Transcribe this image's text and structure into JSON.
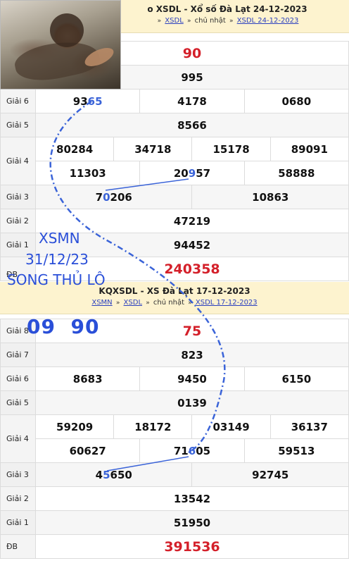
{
  "section1": {
    "title": "KQXSDL - XS Đà Lạt 24-12-2023",
    "title_visible": "o XSDL - Xổ số Đà Lạt 24-12-2023",
    "crumbs": [
      "XSDL",
      "chủ nhật",
      "XSDL 24-12-2023"
    ],
    "prizes": {
      "g8": "90",
      "g7": "995",
      "g6": [
        "9365",
        "4178",
        "0680"
      ],
      "g5": "8566",
      "g4_row1": [
        "80284",
        "34718",
        "15178",
        "89091"
      ],
      "g4_row2": [
        "11303",
        "20957",
        "58888"
      ],
      "g3": [
        "70206",
        "10863"
      ],
      "g2": "47219",
      "g1": "94452",
      "db": "240358"
    }
  },
  "section2": {
    "title": "KQXSDL - XS Đà Lạt 17-12-2023",
    "crumbs": [
      "XSMN",
      "XSDL",
      "chủ nhật",
      "XSDL 17-12-2023"
    ],
    "prizes": {
      "g8": "75",
      "g7": "823",
      "g6": [
        "8683",
        "9450",
        "6150"
      ],
      "g5": "0139",
      "g4_row1": [
        "59209",
        "18172",
        "03149",
        "36137"
      ],
      "g4_row2": [
        "60627",
        "71605",
        "59513"
      ],
      "g3": [
        "45650",
        "92745"
      ],
      "g2": "13542",
      "g1": "51950",
      "db": "391536"
    }
  },
  "labels": {
    "g8": "Giải 8",
    "g7": "Giải 7",
    "g6": "Giải 6",
    "g5": "Giải 5",
    "g4": "Giải 4",
    "g3": "Giải 3",
    "g2": "Giải 2",
    "g1": "Giải 1",
    "db": "ĐB"
  },
  "overlay": {
    "xsmn": "XSMN",
    "date": "31/12/23",
    "song_thu_lo": "SONG THỦ LÔ",
    "numbers": "09  90"
  },
  "colors": {
    "header_bg": "#fdf3cf",
    "link": "#2a3fbf",
    "special_red": "#d4202a",
    "overlay_blue": "#2a4fd8"
  }
}
